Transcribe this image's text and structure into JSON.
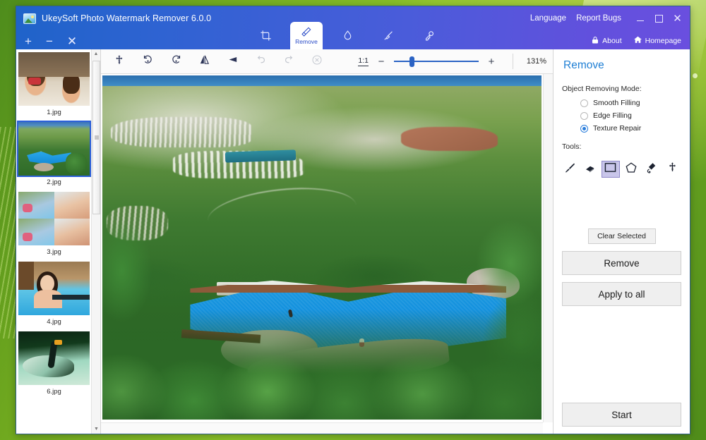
{
  "window": {
    "title": "UkeySoft Photo Watermark Remover 6.0.0",
    "app_icon": "photo-icon",
    "links": {
      "language": "Language",
      "report_bugs": "Report Bugs"
    },
    "controls": {
      "minimize": "minimize",
      "maximize": "maximize",
      "close": "close"
    }
  },
  "toolbar": {
    "file_ops": [
      {
        "name": "add-files",
        "glyph": "+"
      },
      {
        "name": "remove-file",
        "glyph": "−"
      },
      {
        "name": "clear-files",
        "glyph": "✕"
      }
    ],
    "modes": [
      {
        "id": "crop",
        "label": "",
        "icon": "crop-icon",
        "active": false
      },
      {
        "id": "remove",
        "label": "Remove",
        "icon": "eraser-icon",
        "active": true
      },
      {
        "id": "watermark",
        "label": "",
        "icon": "droplet-icon",
        "active": false
      },
      {
        "id": "brush",
        "label": "",
        "icon": "paintbrush-icon",
        "active": false
      },
      {
        "id": "key",
        "label": "",
        "icon": "key-icon",
        "active": false
      }
    ],
    "right_items": [
      {
        "id": "about",
        "label": "About",
        "icon": "lock-icon"
      },
      {
        "id": "homepage",
        "label": "Homepage",
        "icon": "home-icon"
      }
    ]
  },
  "sidebar": {
    "thumbnails": [
      {
        "file": "1.jpg",
        "art": "girls",
        "selected": false
      },
      {
        "file": "2.jpg",
        "art": "aerial",
        "selected": true
      },
      {
        "file": "3.jpg",
        "art": "collage",
        "selected": false
      },
      {
        "file": "4.jpg",
        "art": "woman",
        "selected": false
      },
      {
        "file": "6.jpg",
        "art": "swan",
        "selected": false
      }
    ],
    "scroll": {
      "up_glyph": "▲",
      "down_glyph": "▼"
    }
  },
  "image_toolbar": {
    "buttons": [
      {
        "id": "pan",
        "icon": "move-icon",
        "disabled": false
      },
      {
        "id": "rotate-left",
        "icon": "rotate-left-icon",
        "disabled": false
      },
      {
        "id": "rotate-right",
        "icon": "rotate-right-icon",
        "disabled": false
      },
      {
        "id": "flip-horizontal",
        "icon": "flip-horizontal-icon",
        "disabled": false
      },
      {
        "id": "flip-vertical",
        "icon": "flip-vertical-icon",
        "disabled": false
      },
      {
        "id": "undo",
        "icon": "undo-icon",
        "disabled": true
      },
      {
        "id": "redo",
        "icon": "redo-icon",
        "disabled": true
      },
      {
        "id": "reset",
        "icon": "reset-circle-icon",
        "disabled": true
      }
    ],
    "zoom": {
      "fit_label": "1:1",
      "minus_glyph": "−",
      "plus_glyph": "+",
      "percent": "131%",
      "slider_position_percent": 18
    }
  },
  "right_panel": {
    "title": "Remove",
    "mode_label": "Object Removing Mode:",
    "modes": [
      {
        "label": "Smooth Filling",
        "selected": false
      },
      {
        "label": "Edge Filling",
        "selected": false
      },
      {
        "label": "Texture Repair",
        "selected": true
      }
    ],
    "tools_label": "Tools:",
    "tools": [
      {
        "id": "brush",
        "icon": "brush-icon",
        "active": false
      },
      {
        "id": "eraser",
        "icon": "eraser-icon",
        "active": false
      },
      {
        "id": "rectangle-select",
        "icon": "rectangle-select-icon",
        "active": true
      },
      {
        "id": "polygon-select",
        "icon": "polygon-select-icon",
        "active": false
      },
      {
        "id": "lasso-select",
        "icon": "lasso-pen-icon",
        "active": false
      },
      {
        "id": "move",
        "icon": "move-icon",
        "active": false
      }
    ],
    "clear_selected_label": "Clear Selected",
    "remove_label": "Remove",
    "apply_to_all_label": "Apply to all",
    "start_label": "Start"
  },
  "colors": {
    "title_bar_blue": "#1f63c9",
    "title_bar_purple": "#6a4fdf",
    "accent_blue": "#2a7ddb",
    "panel_title_blue": "#1f7fd4",
    "selected_thumb_border": "#2b5fd9",
    "tool_active_bg": "#c9c6ea",
    "desktop_green": "#6fa81f"
  }
}
